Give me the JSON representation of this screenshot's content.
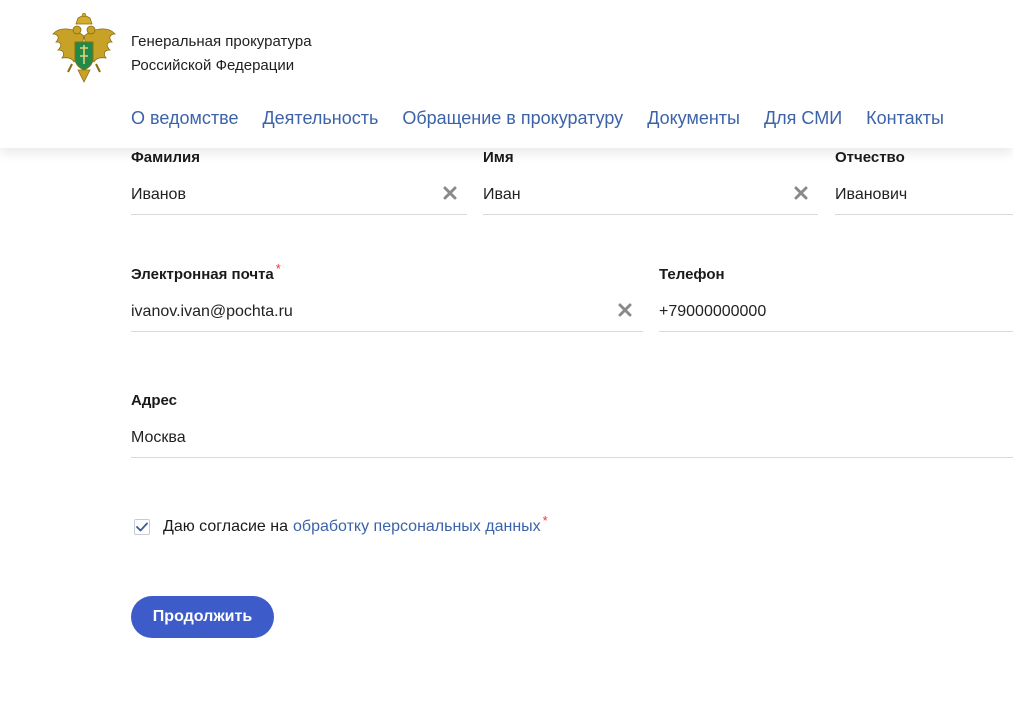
{
  "header": {
    "org_line1": "Генеральная прокуратура",
    "org_line2": "Российской Федерации",
    "nav": [
      {
        "label": "О ведомстве"
      },
      {
        "label": "Деятельность"
      },
      {
        "label": "Обращение в прокуратуру"
      },
      {
        "label": "Документы"
      },
      {
        "label": "Для СМИ"
      },
      {
        "label": "Контакты"
      }
    ]
  },
  "form": {
    "surname": {
      "label": "Фамилия",
      "value": "Иванов"
    },
    "name": {
      "label": "Имя",
      "value": "Иван"
    },
    "patronymic": {
      "label": "Отчество",
      "value": "Иванович"
    },
    "email": {
      "label": "Электронная почта",
      "required_mark": "*",
      "value": "ivanov.ivan@pochta.ru"
    },
    "phone": {
      "label": "Телефон",
      "value": "+79000000000"
    },
    "address": {
      "label": "Адрес",
      "value": "Москва"
    },
    "consent": {
      "checked": true,
      "text": "Даю согласие на",
      "link_text": "обработку персональных данных",
      "required_mark": "*"
    },
    "submit_label": "Продолжить"
  },
  "colors": {
    "link": "#3c63a8",
    "button": "#3e5cc9",
    "required": "#e53935"
  }
}
